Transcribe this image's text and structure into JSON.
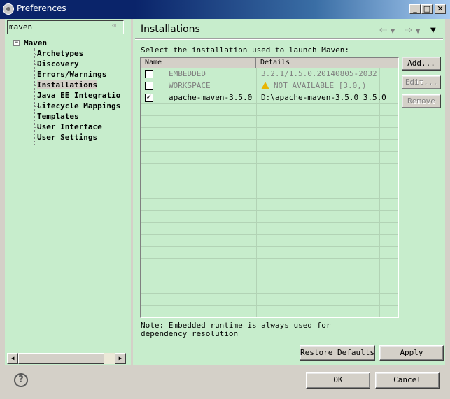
{
  "window": {
    "title": "Preferences",
    "minimize": "_",
    "maximize": "□",
    "close": "✕"
  },
  "sidebar": {
    "filter_value": "maven",
    "tree": {
      "root": "Maven",
      "items": [
        "Archetypes",
        "Discovery",
        "Errors/Warnings",
        "Installations",
        "Java EE Integratio",
        "Lifecycle Mappings",
        "Templates",
        "User Interface",
        "User Settings"
      ],
      "selected": "Installations"
    }
  },
  "page": {
    "title": "Installations",
    "instruction": "Select the installation used to launch Maven:",
    "table": {
      "columns": [
        "Name",
        "Details"
      ],
      "rows": [
        {
          "checked": false,
          "name": "EMBEDDED",
          "details": "3.2.1/1.5.0.20140805-2032",
          "greyed": true
        },
        {
          "checked": false,
          "name": "WORKSPACE",
          "details": "NOT AVAILABLE [3.0,)",
          "greyed": true,
          "warning": true
        },
        {
          "checked": true,
          "name": "apache-maven-3.5.0",
          "details": "D:\\apache-maven-3.5.0 3.5.0",
          "greyed": false
        }
      ]
    },
    "buttons": {
      "add": "Add...",
      "edit": "Edit...",
      "remove": "Remove"
    },
    "note": "Note: Embedded runtime is always used for dependency resolution",
    "restore_defaults": "Restore Defaults",
    "apply": "Apply"
  },
  "footer": {
    "ok": "OK",
    "cancel": "Cancel"
  },
  "colors": {
    "panel_bg": "#c7edcc",
    "window_bg": "#d4d0c8",
    "titlebar": "#0a246a"
  }
}
